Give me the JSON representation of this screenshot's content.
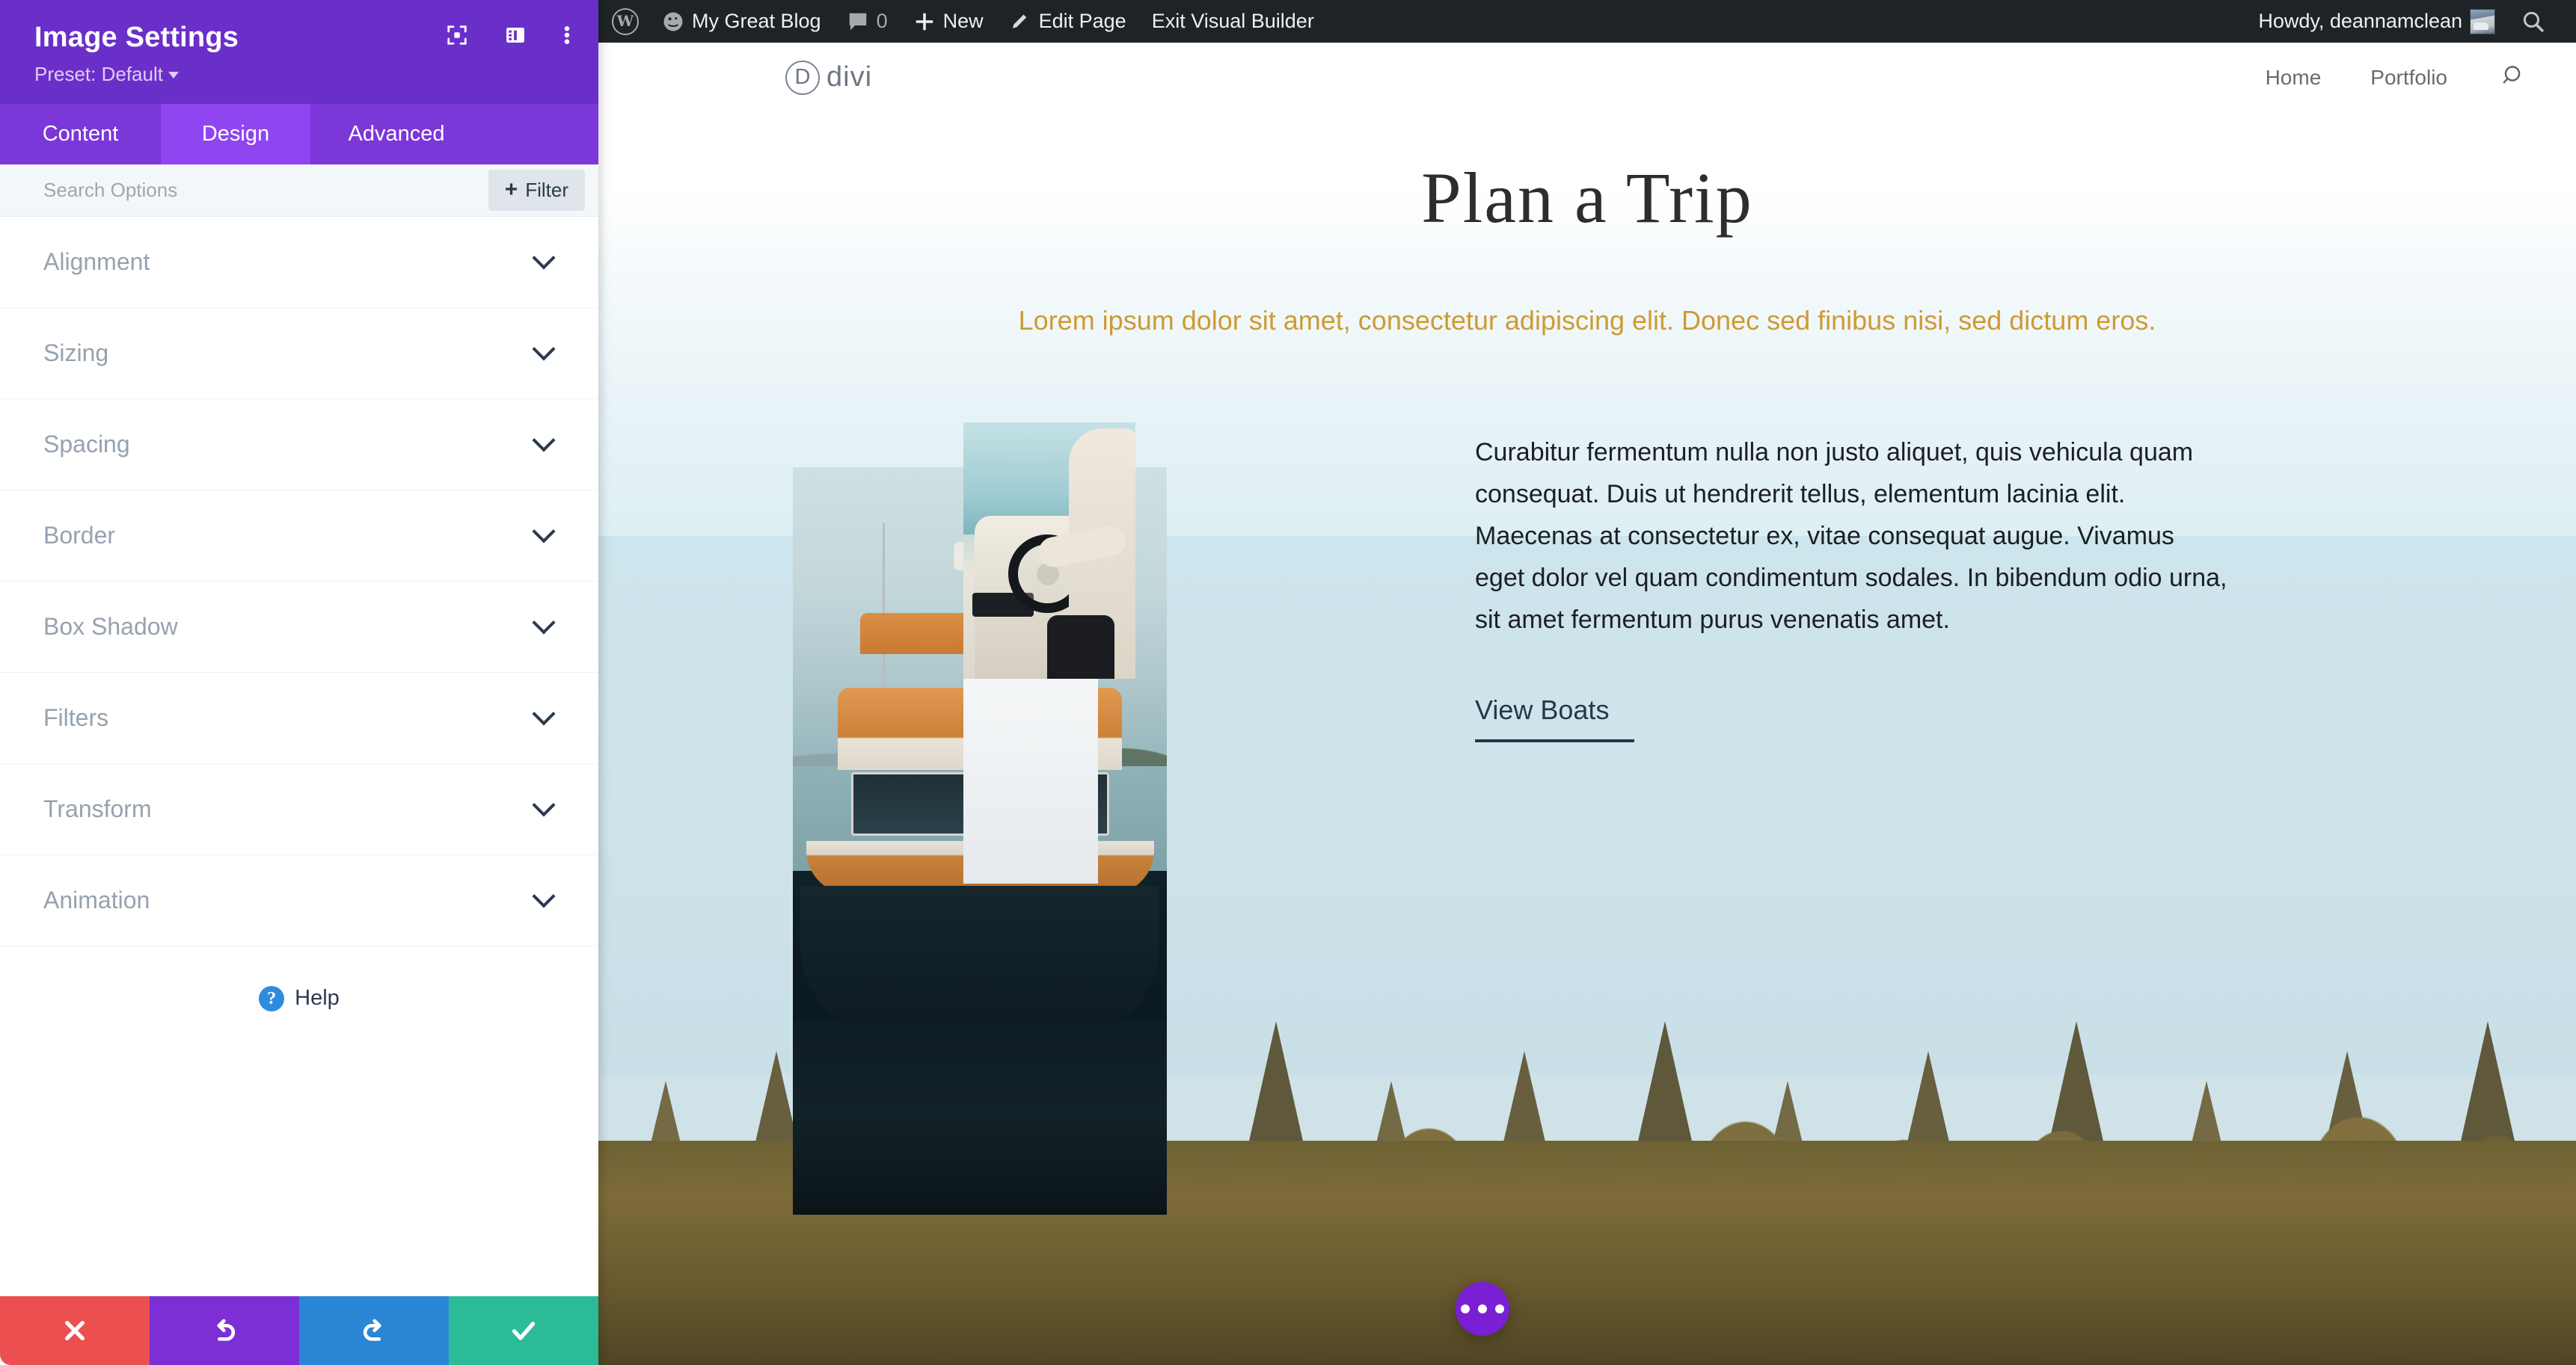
{
  "admin_bar": {
    "wp_logo": "wordpress-logo-icon",
    "site_name": "My Great Blog",
    "comments_count": "0",
    "new_label": "New",
    "edit_page_label": "Edit Page",
    "exit_builder_label": "Exit Visual Builder",
    "greeting": "Howdy, deannamclean",
    "search_icon": "search-icon"
  },
  "settings_panel": {
    "title": "Image Settings",
    "preset_label": "Preset: Default",
    "header_icons": [
      "focus-target-icon",
      "panel-layout-icon",
      "more-vertical-icon"
    ],
    "tabs": [
      {
        "label": "Content",
        "active": false
      },
      {
        "label": "Design",
        "active": true
      },
      {
        "label": "Advanced",
        "active": false
      }
    ],
    "search_placeholder": "Search Options",
    "search_value": "",
    "filter_label": "Filter",
    "options": [
      {
        "label": "Alignment"
      },
      {
        "label": "Sizing"
      },
      {
        "label": "Spacing"
      },
      {
        "label": "Border"
      },
      {
        "label": "Box Shadow"
      },
      {
        "label": "Filters"
      },
      {
        "label": "Transform"
      },
      {
        "label": "Animation"
      }
    ],
    "help_label": "Help",
    "actions": [
      {
        "name": "discard",
        "icon": "close-x-icon",
        "color": "#ec4f4f"
      },
      {
        "name": "undo",
        "icon": "undo-arrow-icon",
        "color": "#7b2fd4"
      },
      {
        "name": "redo",
        "icon": "redo-arrow-icon",
        "color": "#2b86d6"
      },
      {
        "name": "save",
        "icon": "check-icon",
        "color": "#2bbb96"
      }
    ],
    "accent_purple": "#6b2fc9",
    "tabbar_purple": "#7b37d8",
    "active_tab_purple": "#8f45f0"
  },
  "site": {
    "logo_mark": "D",
    "logo_text": "divi",
    "nav": [
      {
        "label": "Home"
      },
      {
        "label": "Portfolio"
      }
    ],
    "nav_search_icon": "search-icon",
    "hero_title": "Plan a Trip",
    "hero_subtitle": "Lorem ipsum dolor sit amet, consectetur adipiscing elit. Donec sed finibus nisi, sed dictum eros.",
    "subtitle_color": "#cf9a33",
    "body_text": "Curabitur fermentum nulla non justo aliquet, quis vehicula quam consequat. Duis ut hendrerit tellus, elementum lacinia elit. Maecenas at consectetur ex, vitae consequat augue. Vivamus eget dolor vel quam condimentum sodales. In bibendum odio urna, sit amet fermentum purus venenatis amet.",
    "cta_label": "View Boats",
    "images": [
      {
        "name": "moored-trawler-yacht-photo"
      },
      {
        "name": "person-at-boat-helm-photo"
      },
      {
        "name": "dock-photo"
      }
    ],
    "fab_icon": "more-horizontal-icon"
  }
}
